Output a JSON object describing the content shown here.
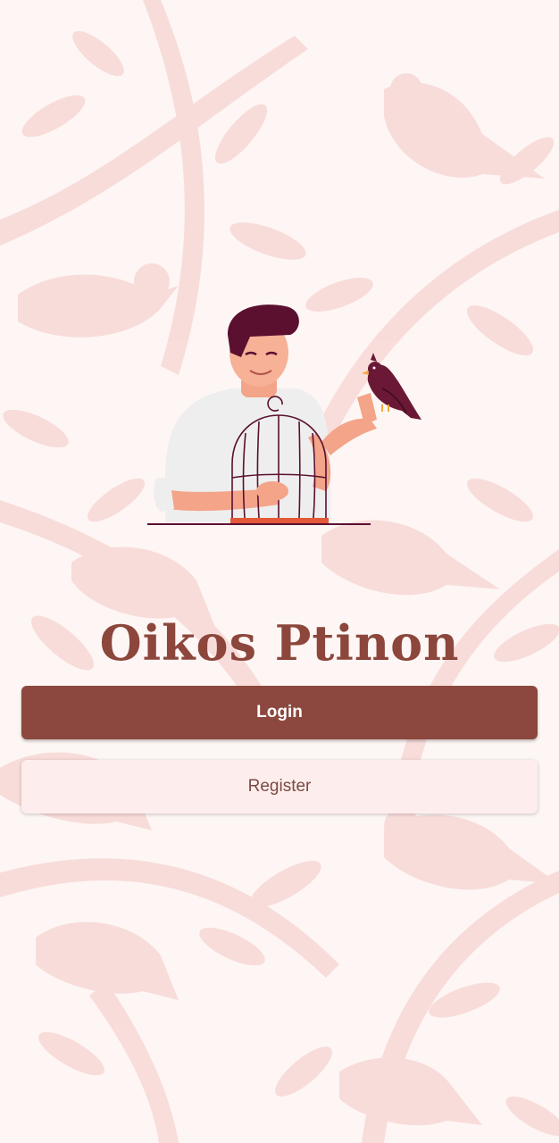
{
  "app": {
    "title": "Oikos Ptinon"
  },
  "actions": {
    "login_label": "Login",
    "register_label": "Register"
  },
  "colors": {
    "background": "#fdf6f4",
    "pattern": "#f8d8d6",
    "brand": "#8c463c",
    "login_button": "#8c473e",
    "register_button": "#fdeeed"
  },
  "illustration": {
    "icon": "man-with-birdcage-and-bird-icon"
  }
}
